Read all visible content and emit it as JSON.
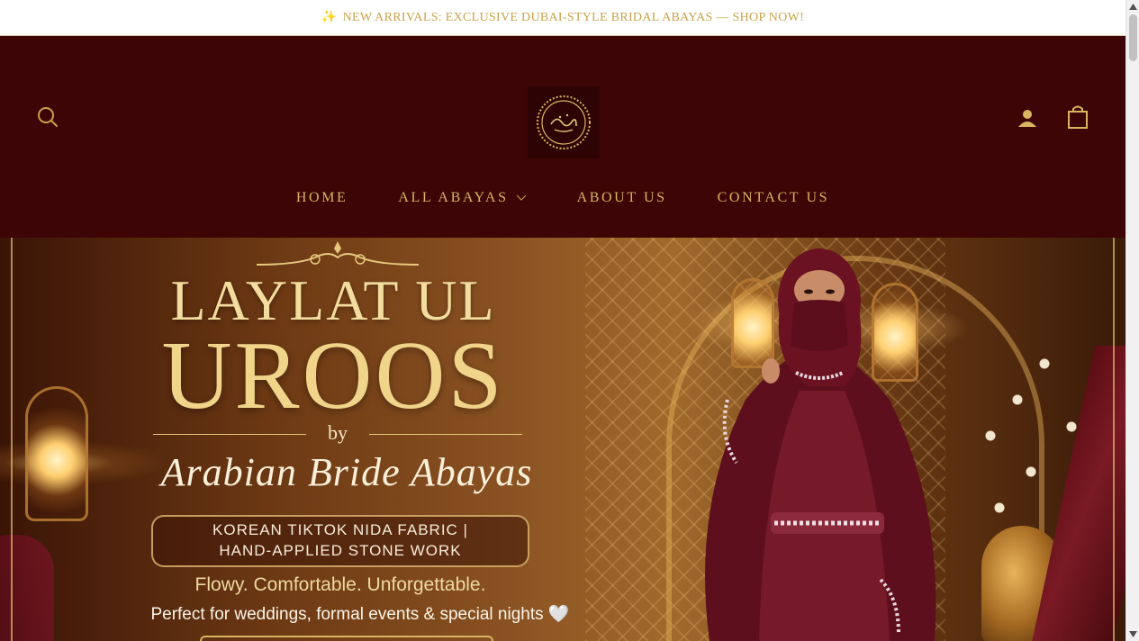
{
  "announcement": {
    "icon": "sparkles-icon",
    "text": "NEW ARRIVALS: EXCLUSIVE DUBAI-STYLE BRIDAL ABAYAS — SHOP NOW!"
  },
  "header": {
    "icons": {
      "search": "search-icon",
      "account": "user-icon",
      "cart": "shopping-bag-icon"
    },
    "logo_alt": "Arabian Bride Abayas"
  },
  "nav": {
    "items": [
      {
        "label": "HOME"
      },
      {
        "label": "ALL ABAYAS",
        "has_dropdown": true
      },
      {
        "label": "ABOUT US"
      },
      {
        "label": "CONTACT US"
      }
    ]
  },
  "hero": {
    "title_line1": "LAYLAT UL",
    "title_line2": "UROOS",
    "by": "by",
    "brand_script": "Arabian Bride Abayas",
    "badge_line1": "KOREAN TIKTOK NIDA FABRIC |",
    "badge_line2": "HAND-APPLIED STONE WORK",
    "tagline": "Flowy. Comfortable. Unforgettable.",
    "subtagline": "Perfect for weddings, formal events & special nights 🤍"
  },
  "colors": {
    "header_bg": "#3d0505",
    "gold": "#d9b461",
    "announcement_text": "#c9a24a"
  }
}
